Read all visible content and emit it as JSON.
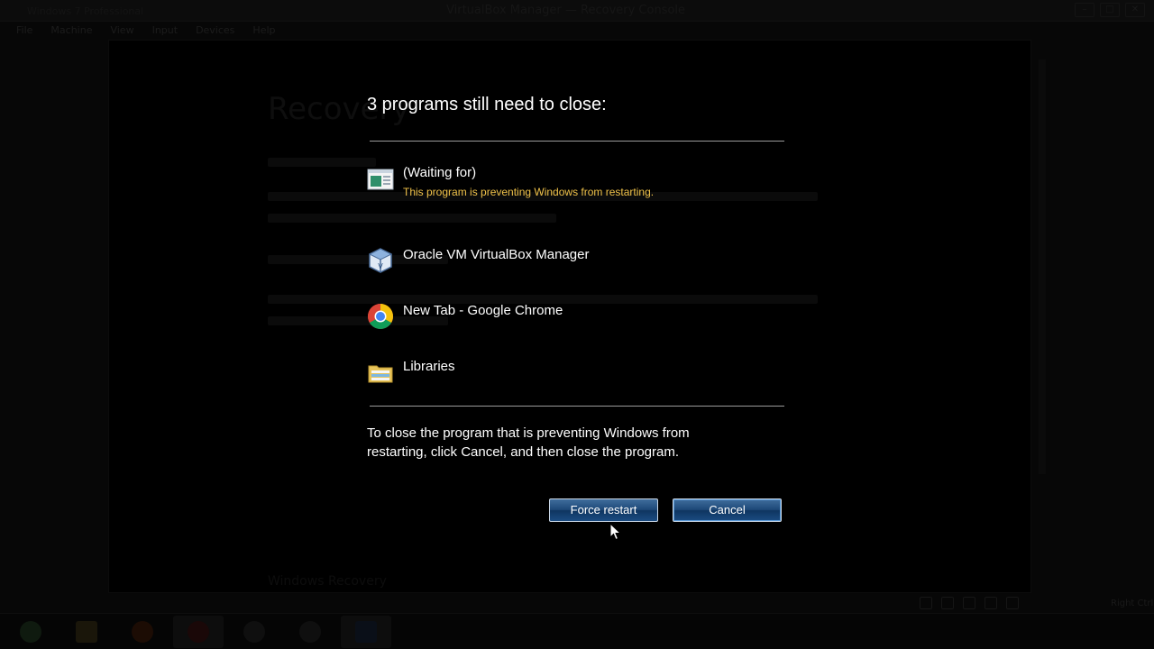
{
  "host": {
    "window_title": "VirtualBox Manager — Recovery Console",
    "left_caption": "Windows 7 Professional",
    "menu": [
      "File",
      "Machine",
      "View",
      "Input",
      "Devices",
      "Help"
    ],
    "vm_background_title": "Recovery",
    "vm_background_footer": "Windows Recovery",
    "host_key": "Right Ctrl"
  },
  "dialog": {
    "title": "3 programs still need to close:",
    "programs": [
      {
        "name": "(Waiting for)",
        "warning": "This program is preventing Windows from restarting.",
        "icon": "window-app-icon"
      },
      {
        "name": "Oracle VM VirtualBox Manager",
        "icon": "virtualbox-icon"
      },
      {
        "name": "New Tab - Google Chrome",
        "icon": "chrome-icon"
      },
      {
        "name": "Libraries",
        "icon": "libraries-folder-icon"
      }
    ],
    "instructions": "To close the program that is preventing Windows from restarting, click Cancel, and then close the program.",
    "force_restart_label": "Force restart",
    "cancel_label": "Cancel"
  },
  "taskbar": {
    "items": [
      "start-orb-icon",
      "explorer-icon",
      "firefox-icon",
      "chrome-icon",
      "app-icon",
      "app-icon",
      "virtualbox-icon"
    ]
  },
  "colors": {
    "warning_text": "#f0c24a",
    "button_top": "#3f6d9c",
    "button_bottom": "#0f3560"
  }
}
